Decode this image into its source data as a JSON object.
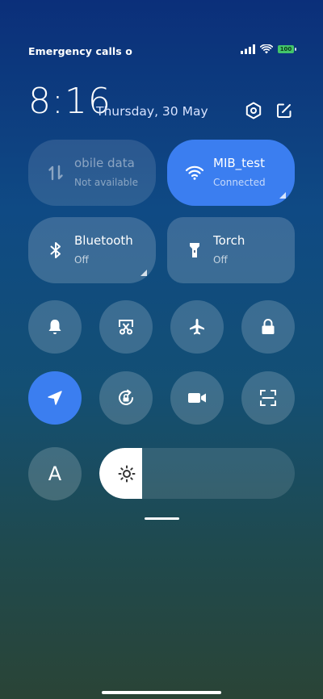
{
  "status": {
    "left_text": "Emergency calls o",
    "battery": "100"
  },
  "header": {
    "time": "8:16",
    "date": "Thursday, 30 May"
  },
  "tiles": [
    {
      "name": "mobile-data",
      "label": "obile data",
      "sub": "Not available"
    },
    {
      "name": "wifi",
      "label": "MIB_test",
      "sub": "Connected"
    },
    {
      "name": "bluetooth",
      "label": "Bluetooth",
      "sub": "Off"
    },
    {
      "name": "torch",
      "label": "Torch",
      "sub": "Off"
    }
  ],
  "round_buttons": [
    {
      "icon": "bell-icon"
    },
    {
      "icon": "screenshot-scissors-icon"
    },
    {
      "icon": "airplane-icon"
    },
    {
      "icon": "lock-icon"
    },
    {
      "icon": "location-arrow-icon"
    },
    {
      "icon": "rotation-lock-icon"
    },
    {
      "icon": "video-camera-icon"
    },
    {
      "icon": "scan-icon"
    }
  ],
  "auto_brightness_label": "A",
  "brightness_level": 0.22,
  "colors": {
    "accent": "#3b7ef0",
    "battery": "#43c56a"
  }
}
